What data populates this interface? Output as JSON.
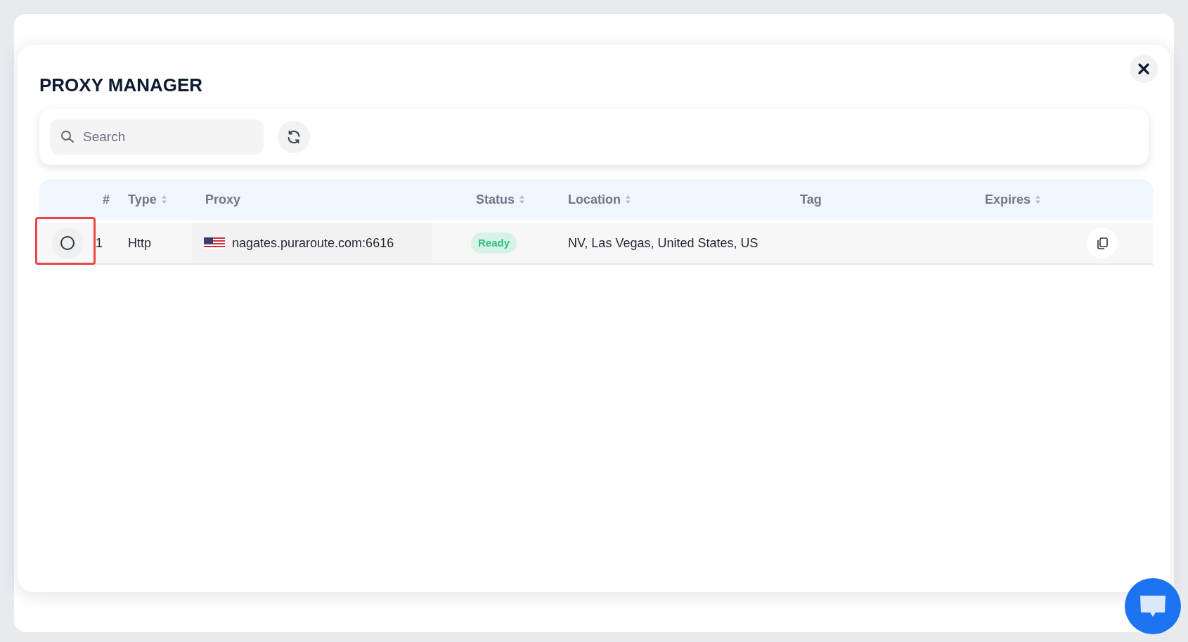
{
  "dialog": {
    "title": "PROXY MANAGER"
  },
  "search": {
    "placeholder": "Search"
  },
  "table": {
    "columns": [
      {
        "label": "#",
        "sortable": false
      },
      {
        "label": "Type",
        "sortable": true
      },
      {
        "label": "Proxy",
        "sortable": false
      },
      {
        "label": "Status",
        "sortable": true
      },
      {
        "label": "Location",
        "sortable": true
      },
      {
        "label": "Tag",
        "sortable": false
      },
      {
        "label": "Expires",
        "sortable": true
      }
    ],
    "rows": [
      {
        "selected": false,
        "highlighted": true,
        "index": "1",
        "type": "Http",
        "proxy": "nagates.puraroute.com:6616",
        "status": {
          "kind": "ready",
          "label": "Ready"
        },
        "location": "NV, Las Vegas, United States, US"
      }
    ]
  }
}
